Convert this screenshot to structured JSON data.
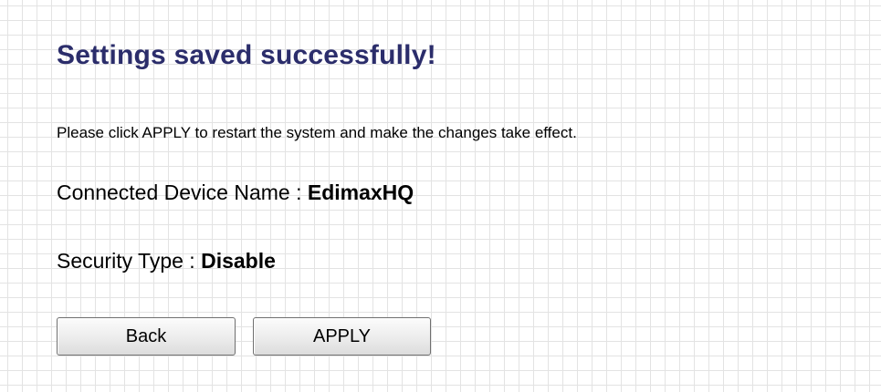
{
  "title": "Settings saved successfully!",
  "instruction": "Please click APPLY to restart the system and make the changes take effect.",
  "device": {
    "label": "Connected Device Name : ",
    "value": "EdimaxHQ"
  },
  "security": {
    "label": "Security Type : ",
    "value": "Disable"
  },
  "buttons": {
    "back_label": "Back",
    "apply_label": "APPLY"
  },
  "colors": {
    "title": "#2b2d6b",
    "grid_line": "#e3e3e3",
    "background": "#ffffff"
  }
}
